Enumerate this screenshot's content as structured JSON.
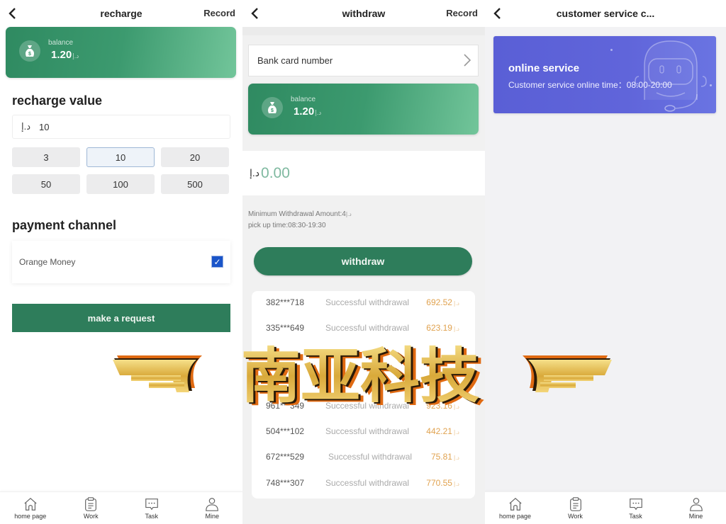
{
  "currency_symbol": "د.إ",
  "recharge": {
    "title": "recharge",
    "record_label": "Record",
    "balance_label": "balance",
    "balance_value": "1.20",
    "recharge_value_heading": "recharge value",
    "amount_input_value": "10",
    "amount_options": [
      "3",
      "10",
      "20",
      "50",
      "100",
      "500"
    ],
    "selected_amount": "10",
    "payment_channel_heading": "payment channel",
    "payment_channel": "Orange Money",
    "payment_channel_checked": true,
    "submit_label": "make a request"
  },
  "withdraw": {
    "title": "withdraw",
    "record_label": "Record",
    "bank_card_label": "Bank card number",
    "balance_label": "balance",
    "balance_value": "1.20",
    "amount_placeholder": "0.00",
    "min_amount_note": "Minimum Withdrawal Amount:4",
    "pickup_time_note": "pick up time:08:30-19:30",
    "submit_label": "withdraw",
    "records": [
      {
        "account": "382***718",
        "status": "Successful withdrawal",
        "amount": "692.52"
      },
      {
        "account": "335***649",
        "status": "Successful withdrawal",
        "amount": "623.19"
      },
      {
        "account": "",
        "status": "",
        "amount": ""
      },
      {
        "account": "",
        "status": "",
        "amount": ""
      },
      {
        "account": "961***349",
        "status": "Successful withdrawal",
        "amount": "923.16"
      },
      {
        "account": "504***102",
        "status": "Successful withdrawal",
        "amount": "442.21"
      },
      {
        "account": "672***529",
        "status": "Successful withdrawal",
        "amount": "75.81"
      },
      {
        "account": "748***307",
        "status": "Successful withdrawal",
        "amount": "770.55"
      }
    ]
  },
  "customer_service": {
    "title": "customer service c...",
    "card_title": "online service",
    "card_subtitle": "Customer service online time：08:00-20:00"
  },
  "tabbar": {
    "items": [
      {
        "label": "home page",
        "icon": "home-icon"
      },
      {
        "label": "Work",
        "icon": "clipboard-icon"
      },
      {
        "label": "Task",
        "icon": "chat-icon"
      },
      {
        "label": "Mine",
        "icon": "user-icon"
      }
    ]
  },
  "watermark": {
    "text": "南亚科技"
  },
  "colors": {
    "primary_green": "#2e7d5b",
    "amount_orange": "#e0a24f",
    "service_purple": "#5a5fd6",
    "checkbox_blue": "#1a55c9"
  }
}
